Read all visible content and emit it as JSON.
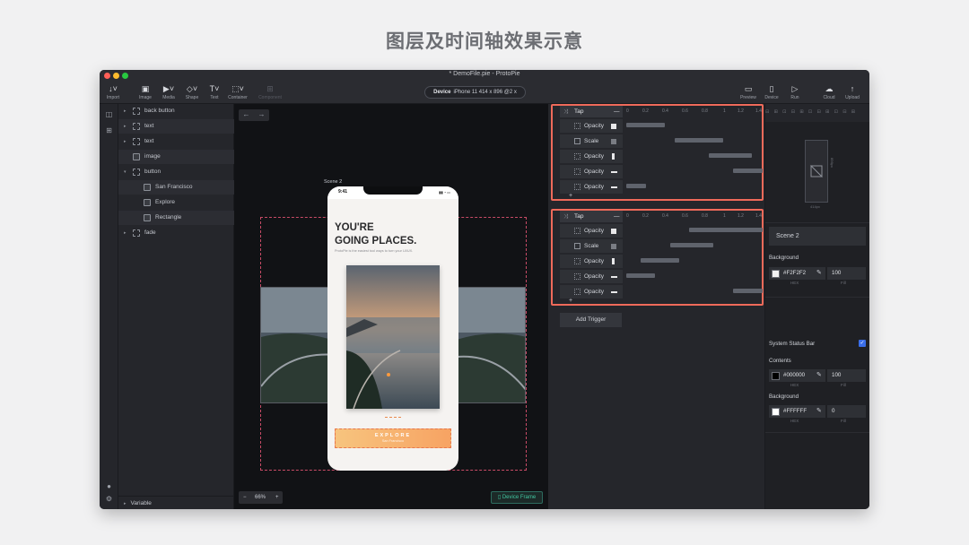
{
  "page_heading": "图层及时间轴效果示意",
  "window": {
    "title": "* DemoFile.pie - ProtoPie",
    "traffic_colors": [
      "#ff5f57",
      "#febc2e",
      "#28c840"
    ]
  },
  "toolbar": {
    "left_tools": [
      {
        "label": "Import",
        "icon": "import-icon"
      },
      {
        "label": "Image",
        "icon": "image-icon"
      },
      {
        "label": "Media",
        "icon": "media-icon"
      },
      {
        "label": "Shape",
        "icon": "shape-icon"
      },
      {
        "label": "Text",
        "icon": "text-icon"
      },
      {
        "label": "Container",
        "icon": "container-icon"
      },
      {
        "label": "Component",
        "icon": "component-icon"
      }
    ],
    "device_label": "Device",
    "device_value": "iPhone 11  414 x 896  @2 x",
    "right_tools": [
      {
        "label": "Preview",
        "icon": "preview-icon"
      },
      {
        "label": "Device",
        "icon": "device-icon"
      },
      {
        "label": "Run",
        "icon": "run-icon"
      },
      {
        "label": "Cloud",
        "icon": "cloud-icon"
      },
      {
        "label": "Upload",
        "icon": "upload-icon"
      }
    ]
  },
  "layers": {
    "items": [
      {
        "label": "back button",
        "depth": 0,
        "arrow": "▸",
        "kind": "container"
      },
      {
        "label": "text",
        "depth": 0,
        "arrow": "▸",
        "kind": "container"
      },
      {
        "label": "text",
        "depth": 0,
        "arrow": "▸",
        "kind": "container"
      },
      {
        "label": "image",
        "depth": 0,
        "arrow": "",
        "kind": "image"
      },
      {
        "label": "button",
        "depth": 0,
        "arrow": "▾",
        "kind": "container"
      },
      {
        "label": "San Francisco",
        "depth": 1,
        "arrow": "",
        "kind": "text"
      },
      {
        "label": "Explore",
        "depth": 1,
        "arrow": "",
        "kind": "text"
      },
      {
        "label": "Rectangle",
        "depth": 1,
        "arrow": "",
        "kind": "image"
      },
      {
        "label": "fade",
        "depth": 0,
        "arrow": "▸",
        "kind": "container"
      }
    ],
    "variable_label": "Variable"
  },
  "canvas": {
    "scene_label": "Scene 2",
    "zoom": "66%",
    "device_frame_label": "Device Frame",
    "phone": {
      "time": "9:41",
      "status": "▮▮ ◔ ▭",
      "headline_1": "YOU'RE",
      "headline_2": "GOING PLACES.",
      "subtitle": "ProtoPie is the easiest tool ways to turn your UI/UX.",
      "button_label": "EXPLORE",
      "button_sub": "San Francisco"
    }
  },
  "timeline": {
    "ruler_ticks": [
      "0",
      "0.2",
      "0.4",
      "0.6",
      "0.8",
      "1",
      "1.2",
      "1.4"
    ],
    "groups": [
      {
        "trigger": "Tap",
        "responses": [
          {
            "label": "Opacity",
            "swatch": "square",
            "bar_start": 0.0,
            "bar_end": 0.4
          },
          {
            "label": "Scale",
            "swatch": "scale",
            "bar_start": 0.5,
            "bar_end": 1.0
          },
          {
            "label": "Opacity",
            "swatch": "thin",
            "bar_start": 0.85,
            "bar_end": 1.3
          },
          {
            "label": "Opacity",
            "swatch": "flat",
            "bar_start": 1.1,
            "bar_end": 1.5
          },
          {
            "label": "Opacity",
            "swatch": "flat",
            "bar_start": 0.0,
            "bar_end": 0.2
          }
        ]
      },
      {
        "trigger": "Tap",
        "responses": [
          {
            "label": "Opacity",
            "swatch": "square",
            "bar_start": 0.65,
            "bar_end": 1.45
          },
          {
            "label": "Scale",
            "swatch": "scale",
            "bar_start": 0.45,
            "bar_end": 0.9
          },
          {
            "label": "Opacity",
            "swatch": "thin",
            "bar_start": 0.15,
            "bar_end": 0.55
          },
          {
            "label": "Opacity",
            "swatch": "flat",
            "bar_start": 0.0,
            "bar_end": 0.3
          },
          {
            "label": "Opacity",
            "swatch": "flat",
            "bar_start": 1.1,
            "bar_end": 1.45
          }
        ]
      }
    ],
    "add_symbol": "+",
    "add_trigger_label": "Add Trigger"
  },
  "properties": {
    "mini_width": "414px",
    "mini_height": "896px",
    "scene_name": "Scene 2",
    "background_label": "Background",
    "background_hex": "#F2F2F2",
    "background_fill": "100",
    "hex_sub": "HEX",
    "fill_sub": "Fill",
    "status_bar_label": "System Status Bar",
    "contents_label": "Contents",
    "contents_hex": "#000000",
    "contents_fill": "100",
    "status_bg_label": "Background",
    "status_bg_hex": "#FFFFFF",
    "status_bg_fill": "0",
    "colors": {
      "f2": "#F2F2F2",
      "black": "#000000",
      "white": "#FFFFFF",
      "accent": "#ef6a5a",
      "checkbox": "#3a6ee8"
    }
  }
}
